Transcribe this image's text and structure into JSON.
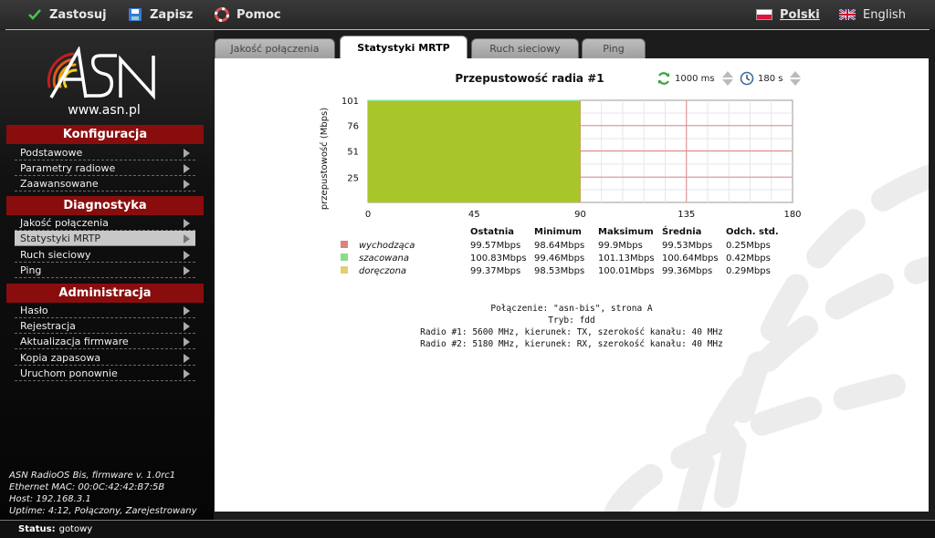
{
  "toolbar": {
    "apply_label": "Zastosuj",
    "save_label": "Zapisz",
    "help_label": "Pomoc",
    "lang_pl": "Polski",
    "lang_en": "English"
  },
  "sidebar": {
    "logo_text": "ASN",
    "url": "www.asn.pl",
    "sections": [
      {
        "title": "Konfiguracja",
        "items": [
          "Podstawowe",
          "Parametry radiowe",
          "Zaawansowane"
        ]
      },
      {
        "title": "Diagnostyka",
        "items": [
          "Jakość połączenia",
          "Statystyki MRTP",
          "Ruch sieciowy",
          "Ping"
        ]
      },
      {
        "title": "Administracja",
        "items": [
          "Hasło",
          "Rejestracja",
          "Aktualizacja firmware",
          "Kopia zapasowa",
          "Uruchom ponownie"
        ]
      }
    ],
    "active_item": "Statystyki MRTP",
    "info": [
      "ASN RadioOS Bis, firmware v. 1.0rc1",
      "Ethernet MAC: 00:0C:42:42:B7:5B",
      "Host: 192.168.3.1",
      "Uptime:  4:12, Połączony, Zarejestrowany"
    ]
  },
  "tabs": [
    "Jakość połączenia",
    "Statystyki MRTP",
    "Ruch sieciowy",
    "Ping"
  ],
  "active_tab": "Statystyki MRTP",
  "panel": {
    "title": "Przepustowość radia #1",
    "interval": "1000 ms",
    "window": "180 s"
  },
  "chart_data": {
    "type": "area",
    "title": "Przepustowość radia #1",
    "ylabel": "przepustowość (Mbps)",
    "xlabel": "",
    "xlim": [
      0,
      180
    ],
    "ylim": [
      0,
      101
    ],
    "xticks": [
      0,
      45,
      90,
      135,
      180
    ],
    "yticks": [
      25,
      51,
      76,
      101
    ],
    "grid": true,
    "series": [
      {
        "name": "wychodząca",
        "color": "#e58a8a",
        "x": [
          0,
          90
        ],
        "values": [
          99.57,
          99.57
        ]
      },
      {
        "name": "szacowana",
        "color": "#8fe08f",
        "x": [
          0,
          90
        ],
        "values": [
          100.83,
          100.83
        ]
      },
      {
        "name": "doręczona",
        "color": "#a8c52a",
        "x": [
          0,
          90
        ],
        "values": [
          99.37,
          99.37
        ]
      }
    ]
  },
  "stats": {
    "headers": [
      "",
      "Ostatnia",
      "Minimum",
      "Maksimum",
      "Średnia",
      "Odch. std."
    ],
    "rows": [
      {
        "name": "wychodząca",
        "color": "#e08080",
        "values": [
          "99.57Mbps",
          "98.64Mbps",
          "99.9Mbps",
          "99.53Mbps",
          "0.25Mbps"
        ]
      },
      {
        "name": "szacowana",
        "color": "#88dd88",
        "values": [
          "100.83Mbps",
          "99.46Mbps",
          "101.13Mbps",
          "100.64Mbps",
          "0.42Mbps"
        ]
      },
      {
        "name": "doręczona",
        "color": "#e0d070",
        "values": [
          "99.37Mbps",
          "98.53Mbps",
          "100.01Mbps",
          "99.36Mbps",
          "0.29Mbps"
        ]
      }
    ]
  },
  "connection": [
    "Połączenie: \"asn-bis\", strona A",
    "Tryb: fdd",
    "Radio #1: 5600 MHz, kierunek: TX, szerokość kanału: 40 MHz",
    "Radio #2: 5180 MHz, kierunek: RX, szerokość kanału: 40 MHz"
  ],
  "status": {
    "label": "Status:",
    "value": "gotowy"
  }
}
